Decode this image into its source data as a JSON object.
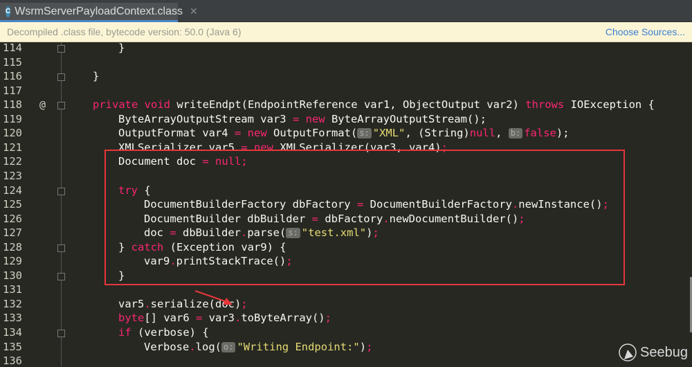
{
  "tab": {
    "title": "WsrmServerPayloadContext.class",
    "icon": "class-file-icon",
    "icon_letter": "C"
  },
  "banner": {
    "text": "Decompiled .class file, bytecode version: 50.0 (Java 6)",
    "link": "Choose Sources..."
  },
  "watermark": "Seebug",
  "colors": {
    "keyword": "#f92672",
    "string": "#e6db74",
    "text": "#f8f8f2",
    "background": "#272822",
    "highlight_box": "#e8363a"
  },
  "lines": [
    {
      "n": "114",
      "indent": 1,
      "t": [
        [
          "",
          "}"
        ]
      ]
    },
    {
      "n": "115",
      "indent": 0,
      "t": []
    },
    {
      "n": "116",
      "indent": 0,
      "t": [
        [
          "",
          "}"
        ]
      ]
    },
    {
      "n": "117",
      "indent": 0,
      "t": []
    },
    {
      "n": "118",
      "indent": 0,
      "at": "@",
      "t": [
        [
          "k",
          "private void "
        ],
        [
          "",
          "writeEndpt(EndpointReference var1, ObjectOutput var2) "
        ],
        [
          "k",
          "throws "
        ],
        [
          "",
          "IOException {"
        ]
      ]
    },
    {
      "n": "119",
      "indent": 1,
      "t": [
        [
          "",
          "ByteArrayOutputStream var3 "
        ],
        [
          "p",
          "= "
        ],
        [
          "k",
          "new "
        ],
        [
          "",
          "ByteArrayOutputStream();"
        ]
      ]
    },
    {
      "n": "120",
      "indent": 1,
      "t": [
        [
          "",
          "OutputFormat var4 "
        ],
        [
          "p",
          "= "
        ],
        [
          "k",
          "new "
        ],
        [
          "",
          "OutputFormat("
        ],
        [
          "h",
          "s:"
        ],
        [
          "s",
          "\"XML\""
        ],
        [
          "",
          ", (String)"
        ],
        [
          "k",
          "null"
        ],
        [
          "",
          ", "
        ],
        [
          "h",
          "b:"
        ],
        [
          "k",
          "false"
        ],
        [
          "",
          ");"
        ]
      ]
    },
    {
      "n": "121",
      "indent": 1,
      "t": [
        [
          "",
          "XMLSerializer var5 "
        ],
        [
          "p",
          "= "
        ],
        [
          "k",
          "new "
        ],
        [
          "",
          "XMLSerializer(var3, var4)"
        ],
        [
          "p",
          ";"
        ]
      ]
    },
    {
      "n": "122",
      "indent": 1,
      "t": [
        [
          "",
          "Document doc "
        ],
        [
          "p",
          "= "
        ],
        [
          "k",
          "null"
        ],
        [
          "p",
          ";"
        ]
      ]
    },
    {
      "n": "123",
      "indent": 0,
      "t": []
    },
    {
      "n": "124",
      "indent": 1,
      "t": [
        [
          "k",
          "try "
        ],
        [
          "",
          "{"
        ]
      ]
    },
    {
      "n": "125",
      "indent": 2,
      "t": [
        [
          "",
          "DocumentBuilderFactory dbFactory "
        ],
        [
          "p",
          "= "
        ],
        [
          "",
          "DocumentBuilderFactory"
        ],
        [
          "p",
          "."
        ],
        [
          "",
          "newInstance()"
        ],
        [
          "p",
          ";"
        ]
      ]
    },
    {
      "n": "126",
      "indent": 2,
      "t": [
        [
          "",
          "DocumentBuilder dbBuilder "
        ],
        [
          "p",
          "= "
        ],
        [
          "",
          "dbFactory"
        ],
        [
          "p",
          "."
        ],
        [
          "",
          "newDocumentBuilder()"
        ],
        [
          "p",
          ";"
        ]
      ]
    },
    {
      "n": "127",
      "indent": 2,
      "t": [
        [
          "",
          "doc "
        ],
        [
          "p",
          "= "
        ],
        [
          "",
          "dbBuilder"
        ],
        [
          "p",
          "."
        ],
        [
          "",
          "parse("
        ],
        [
          "h",
          "s:"
        ],
        [
          "s",
          "\"test.xml\""
        ],
        [
          "",
          ")"
        ],
        [
          "p",
          ";"
        ]
      ]
    },
    {
      "n": "128",
      "indent": 1,
      "t": [
        [
          "",
          "} "
        ],
        [
          "k",
          "catch "
        ],
        [
          "",
          "(Exception var9) {"
        ]
      ]
    },
    {
      "n": "129",
      "indent": 2,
      "t": [
        [
          "",
          "var9"
        ],
        [
          "p",
          "."
        ],
        [
          "",
          "printStackTrace()"
        ],
        [
          "p",
          ";"
        ]
      ]
    },
    {
      "n": "130",
      "indent": 1,
      "t": [
        [
          "",
          "}"
        ]
      ]
    },
    {
      "n": "131",
      "indent": 0,
      "t": []
    },
    {
      "n": "132",
      "indent": 1,
      "t": [
        [
          "",
          "var5"
        ],
        [
          "p",
          "."
        ],
        [
          "",
          "serialize(doc)"
        ],
        [
          "p",
          ";"
        ]
      ]
    },
    {
      "n": "133",
      "indent": 1,
      "t": [
        [
          "k",
          "byte"
        ],
        [
          "",
          "[] var6 "
        ],
        [
          "p",
          "= "
        ],
        [
          "",
          "var3"
        ],
        [
          "p",
          "."
        ],
        [
          "",
          "toByteArray()"
        ],
        [
          "p",
          ";"
        ]
      ]
    },
    {
      "n": "134",
      "indent": 1,
      "t": [
        [
          "k",
          "if "
        ],
        [
          "",
          "(verbose) {"
        ]
      ]
    },
    {
      "n": "135",
      "indent": 2,
      "t": [
        [
          "",
          "Verbose"
        ],
        [
          "p",
          "."
        ],
        [
          "",
          "log("
        ],
        [
          "h",
          "o:"
        ],
        [
          "s",
          "\"Writing Endpoint:\""
        ],
        [
          "",
          ")"
        ],
        [
          "p",
          ";"
        ]
      ]
    },
    {
      "n": "136",
      "indent": 0,
      "t": []
    }
  ]
}
